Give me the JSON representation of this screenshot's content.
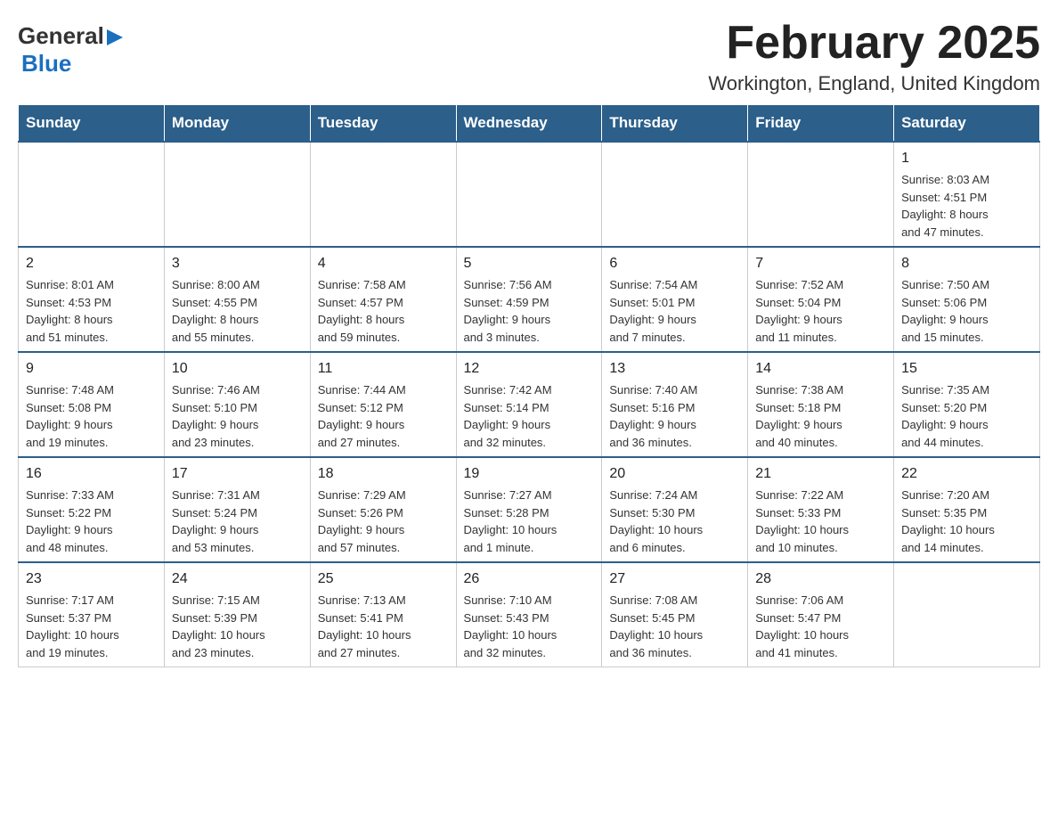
{
  "header": {
    "logo_general": "General",
    "logo_blue": "Blue",
    "month_title": "February 2025",
    "location": "Workington, England, United Kingdom"
  },
  "weekdays": [
    "Sunday",
    "Monday",
    "Tuesday",
    "Wednesday",
    "Thursday",
    "Friday",
    "Saturday"
  ],
  "weeks": [
    [
      {
        "day": "",
        "info": ""
      },
      {
        "day": "",
        "info": ""
      },
      {
        "day": "",
        "info": ""
      },
      {
        "day": "",
        "info": ""
      },
      {
        "day": "",
        "info": ""
      },
      {
        "day": "",
        "info": ""
      },
      {
        "day": "1",
        "info": "Sunrise: 8:03 AM\nSunset: 4:51 PM\nDaylight: 8 hours\nand 47 minutes."
      }
    ],
    [
      {
        "day": "2",
        "info": "Sunrise: 8:01 AM\nSunset: 4:53 PM\nDaylight: 8 hours\nand 51 minutes."
      },
      {
        "day": "3",
        "info": "Sunrise: 8:00 AM\nSunset: 4:55 PM\nDaylight: 8 hours\nand 55 minutes."
      },
      {
        "day": "4",
        "info": "Sunrise: 7:58 AM\nSunset: 4:57 PM\nDaylight: 8 hours\nand 59 minutes."
      },
      {
        "day": "5",
        "info": "Sunrise: 7:56 AM\nSunset: 4:59 PM\nDaylight: 9 hours\nand 3 minutes."
      },
      {
        "day": "6",
        "info": "Sunrise: 7:54 AM\nSunset: 5:01 PM\nDaylight: 9 hours\nand 7 minutes."
      },
      {
        "day": "7",
        "info": "Sunrise: 7:52 AM\nSunset: 5:04 PM\nDaylight: 9 hours\nand 11 minutes."
      },
      {
        "day": "8",
        "info": "Sunrise: 7:50 AM\nSunset: 5:06 PM\nDaylight: 9 hours\nand 15 minutes."
      }
    ],
    [
      {
        "day": "9",
        "info": "Sunrise: 7:48 AM\nSunset: 5:08 PM\nDaylight: 9 hours\nand 19 minutes."
      },
      {
        "day": "10",
        "info": "Sunrise: 7:46 AM\nSunset: 5:10 PM\nDaylight: 9 hours\nand 23 minutes."
      },
      {
        "day": "11",
        "info": "Sunrise: 7:44 AM\nSunset: 5:12 PM\nDaylight: 9 hours\nand 27 minutes."
      },
      {
        "day": "12",
        "info": "Sunrise: 7:42 AM\nSunset: 5:14 PM\nDaylight: 9 hours\nand 32 minutes."
      },
      {
        "day": "13",
        "info": "Sunrise: 7:40 AM\nSunset: 5:16 PM\nDaylight: 9 hours\nand 36 minutes."
      },
      {
        "day": "14",
        "info": "Sunrise: 7:38 AM\nSunset: 5:18 PM\nDaylight: 9 hours\nand 40 minutes."
      },
      {
        "day": "15",
        "info": "Sunrise: 7:35 AM\nSunset: 5:20 PM\nDaylight: 9 hours\nand 44 minutes."
      }
    ],
    [
      {
        "day": "16",
        "info": "Sunrise: 7:33 AM\nSunset: 5:22 PM\nDaylight: 9 hours\nand 48 minutes."
      },
      {
        "day": "17",
        "info": "Sunrise: 7:31 AM\nSunset: 5:24 PM\nDaylight: 9 hours\nand 53 minutes."
      },
      {
        "day": "18",
        "info": "Sunrise: 7:29 AM\nSunset: 5:26 PM\nDaylight: 9 hours\nand 57 minutes."
      },
      {
        "day": "19",
        "info": "Sunrise: 7:27 AM\nSunset: 5:28 PM\nDaylight: 10 hours\nand 1 minute."
      },
      {
        "day": "20",
        "info": "Sunrise: 7:24 AM\nSunset: 5:30 PM\nDaylight: 10 hours\nand 6 minutes."
      },
      {
        "day": "21",
        "info": "Sunrise: 7:22 AM\nSunset: 5:33 PM\nDaylight: 10 hours\nand 10 minutes."
      },
      {
        "day": "22",
        "info": "Sunrise: 7:20 AM\nSunset: 5:35 PM\nDaylight: 10 hours\nand 14 minutes."
      }
    ],
    [
      {
        "day": "23",
        "info": "Sunrise: 7:17 AM\nSunset: 5:37 PM\nDaylight: 10 hours\nand 19 minutes."
      },
      {
        "day": "24",
        "info": "Sunrise: 7:15 AM\nSunset: 5:39 PM\nDaylight: 10 hours\nand 23 minutes."
      },
      {
        "day": "25",
        "info": "Sunrise: 7:13 AM\nSunset: 5:41 PM\nDaylight: 10 hours\nand 27 minutes."
      },
      {
        "day": "26",
        "info": "Sunrise: 7:10 AM\nSunset: 5:43 PM\nDaylight: 10 hours\nand 32 minutes."
      },
      {
        "day": "27",
        "info": "Sunrise: 7:08 AM\nSunset: 5:45 PM\nDaylight: 10 hours\nand 36 minutes."
      },
      {
        "day": "28",
        "info": "Sunrise: 7:06 AM\nSunset: 5:47 PM\nDaylight: 10 hours\nand 41 minutes."
      },
      {
        "day": "",
        "info": ""
      }
    ]
  ]
}
